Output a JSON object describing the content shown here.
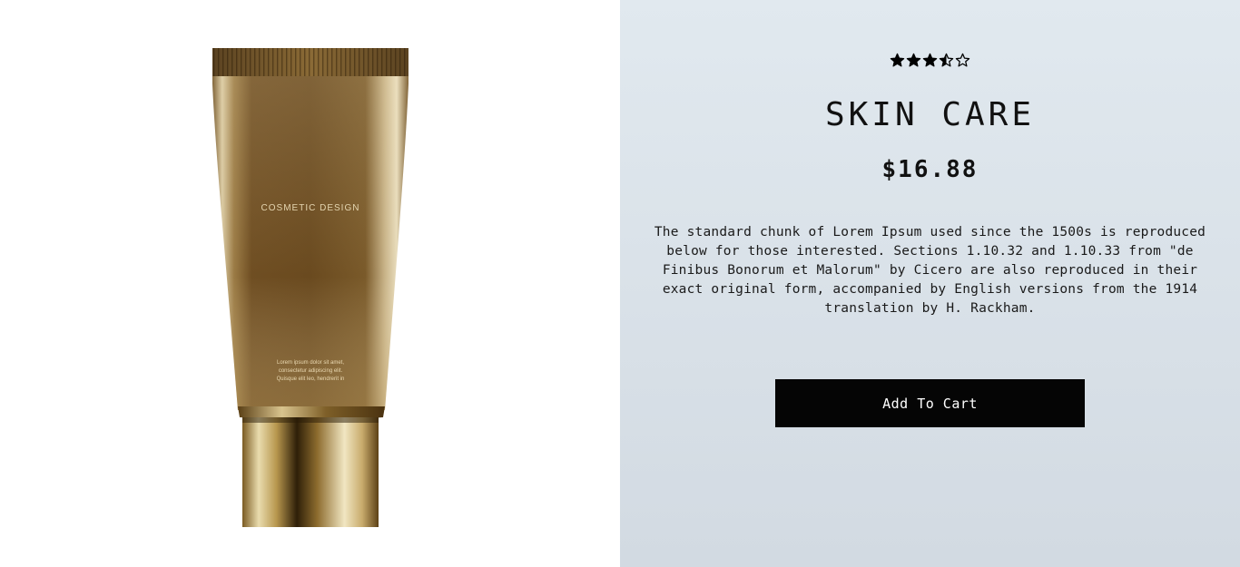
{
  "product": {
    "rating": 3.5,
    "rating_max": 5,
    "title": "SKIN CARE",
    "price": "$16.88",
    "description": "The standard chunk of Lorem Ipsum used since the 1500s is reproduced below for those interested. Sections 1.10.32 and 1.10.33 from \"de Finibus Bonorum et Malorum\" by Cicero are also reproduced in their exact original form, accompanied by English versions from the 1914 translation by H. Rackham.",
    "add_to_cart_label": "Add To Cart",
    "image": {
      "tube_brand_text": "COSMETIC DESIGN",
      "tube_small_text": [
        "Lorem ipsum dolor sit amet,",
        "consectetur adipiscing elit.",
        "Quisque elit leo, hendrerit in"
      ]
    }
  },
  "colors": {
    "info_background_top": "#e1e9ef",
    "info_background_bottom": "#d2dae2",
    "button_background": "#050505",
    "button_text": "#ffffff",
    "tube_gold": "#8a6a30"
  }
}
